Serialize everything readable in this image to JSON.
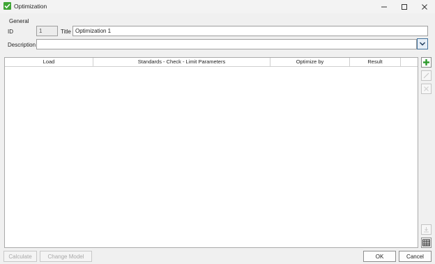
{
  "window": {
    "title": "Optimization",
    "minimize_icon": "minimize-icon",
    "maximize_icon": "maximize-icon",
    "close_icon": "close-icon"
  },
  "general": {
    "section_label": "General",
    "id_label": "ID",
    "id_value": "1",
    "title_label": "Title",
    "title_value": "Optimization 1",
    "description_label": "Description",
    "description_value": ""
  },
  "table": {
    "columns": [
      "Load",
      "Standards - Check - Limit Parameters",
      "Optimize by",
      "Result"
    ],
    "rows": []
  },
  "side_toolbar": {
    "add_icon": "plus-icon",
    "edit_icon": "pencil-icon",
    "delete_icon": "delete-icon",
    "import_icon": "import-icon",
    "table_icon": "table-icon"
  },
  "footer": {
    "calculate_label": "Calculate",
    "change_model_label": "Change Model",
    "ok_label": "OK",
    "cancel_label": "Cancel"
  },
  "colors": {
    "accent_green": "#3fa535",
    "dropdown_border": "#41719c"
  }
}
